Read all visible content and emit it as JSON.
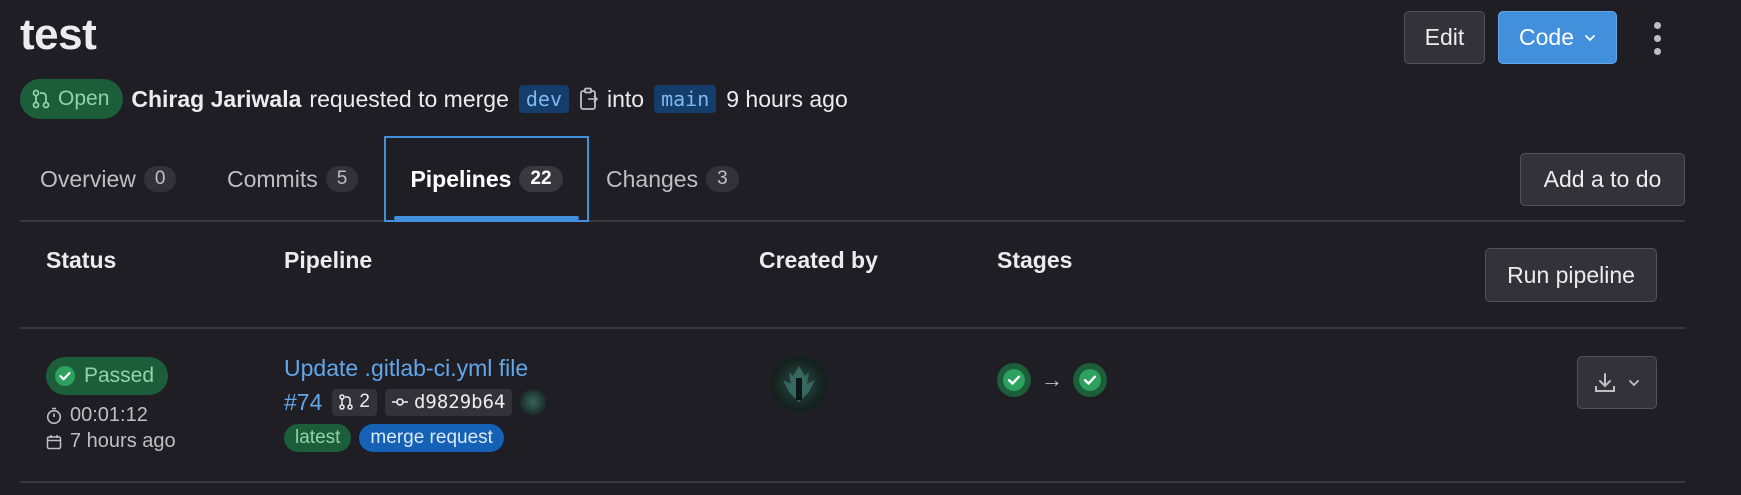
{
  "header": {
    "title": "test",
    "edit_label": "Edit",
    "code_label": "Code"
  },
  "meta": {
    "status": "Open",
    "author": "Chirag Jariwala",
    "action": "requested to merge",
    "source_branch": "dev",
    "into": "into",
    "target_branch": "main",
    "time": "9 hours ago"
  },
  "tabs": [
    {
      "label": "Overview",
      "count": "0"
    },
    {
      "label": "Commits",
      "count": "5"
    },
    {
      "label": "Pipelines",
      "count": "22"
    },
    {
      "label": "Changes",
      "count": "3"
    }
  ],
  "add_todo_label": "Add a to do",
  "table": {
    "headers": [
      "Status",
      "Pipeline",
      "Created by",
      "Stages"
    ],
    "run_pipeline_label": "Run pipeline",
    "rows": [
      {
        "status": "Passed",
        "duration": "00:01:12",
        "finished": "7 hours ago",
        "title": "Update .gitlab-ci.yml file",
        "pipeline_id": "#74",
        "mr_count": "2",
        "commit_sha": "d9829b64",
        "tags": [
          "latest",
          "merge request"
        ],
        "stages": [
          "passed",
          "passed"
        ]
      }
    ]
  },
  "colors": {
    "background": "#1f1e24",
    "accent": "#428fdc",
    "success_bg": "#1c5e3a",
    "success_fg": "#91d4a8",
    "link": "#63a6e9"
  },
  "icons": {
    "open": "merge-request-icon",
    "copy": "copy-icon",
    "chevron": "chevron-down-icon",
    "kebab": "kebab-icon",
    "passed": "status-success-icon",
    "timer": "timer-icon",
    "calendar": "calendar-icon",
    "commit": "commit-icon",
    "download": "download-icon",
    "arrow": "arrow-right-icon"
  }
}
